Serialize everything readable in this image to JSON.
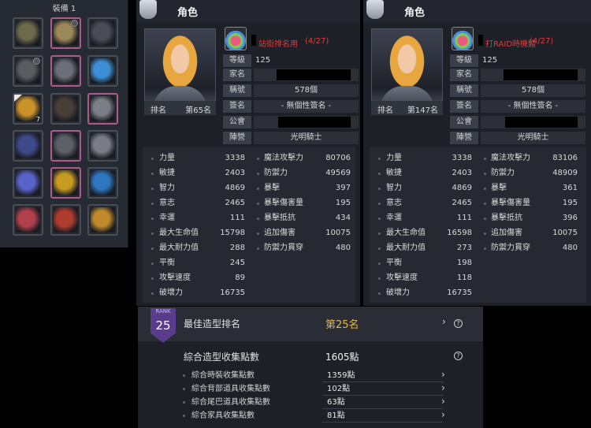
{
  "equipment": {
    "title": "裝備 1",
    "slots": [
      {
        "icon": "necklace-icon",
        "color": "#6b6a4a"
      },
      {
        "icon": "sword-icon",
        "color": "#9c8858"
      },
      {
        "icon": "helmet-icon",
        "color": "#4a4d55"
      },
      {
        "icon": "spear-icon",
        "color": "#5a5d60"
      },
      {
        "icon": "armor-icon",
        "color": "#6c6f78"
      },
      {
        "icon": "gem-icon",
        "color": "#3d8ed6"
      },
      {
        "icon": "potion-icon",
        "color": "#c9922b",
        "count": "7"
      },
      {
        "icon": "cloak-icon",
        "color": "#4a3f38"
      },
      {
        "icon": "glove-icon",
        "color": "#7b7e86"
      },
      {
        "icon": "belt-icon",
        "color": "#3f4a8c"
      },
      {
        "icon": "boots-icon",
        "color": "#5e6068"
      },
      {
        "icon": "shield-icon",
        "color": "#7a7d85"
      },
      {
        "icon": "ring-icon",
        "color": "#5a63c9"
      },
      {
        "icon": "emblem-icon",
        "color": "#c79a22"
      },
      {
        "icon": "bracelet-icon",
        "color": "#2f76c2"
      },
      {
        "icon": "ring-icon",
        "color": "#b2404a"
      },
      {
        "icon": "earring-icon",
        "color": "#b03c2e"
      },
      {
        "icon": "ring-icon",
        "color": "#c08a2a"
      }
    ]
  },
  "panels": [
    {
      "header": "角色",
      "title": "站街排名用",
      "title_count": "(4/27)",
      "level_label": "等級",
      "level": "125",
      "family_label": "家名",
      "nickname_label": "稱號",
      "nickname": "578個",
      "signature_label": "簽名",
      "signature": "- 無個性簽名 -",
      "guild_label": "公會",
      "camp_label": "陣營",
      "camp": "光明騎士",
      "rank_label": "排名",
      "rank": "第65名",
      "stats_left": [
        {
          "label": "力量",
          "value": "3338"
        },
        {
          "label": "敏捷",
          "value": "2403"
        },
        {
          "label": "智力",
          "value": "4869"
        },
        {
          "label": "意志",
          "value": "2465"
        },
        {
          "label": "幸運",
          "value": "111"
        },
        {
          "label": "最大生命值",
          "value": "15798"
        },
        {
          "label": "最大耐力值",
          "value": "288"
        },
        {
          "label": "平衡",
          "value": "245"
        },
        {
          "label": "攻擊速度",
          "value": "89"
        },
        {
          "label": "破壞力",
          "value": "16735"
        }
      ],
      "stats_right": [
        {
          "label": "魔法攻擊力",
          "value": "80706"
        },
        {
          "label": "防禦力",
          "value": "49569"
        },
        {
          "label": "暴擊",
          "value": "397"
        },
        {
          "label": "暴擊傷害量",
          "value": "195"
        },
        {
          "label": "暴擊抵抗",
          "value": "434"
        },
        {
          "label": "追加傷害",
          "value": "10075"
        },
        {
          "label": "防禦力貫穿",
          "value": "480"
        }
      ]
    },
    {
      "header": "角色",
      "title": "打RAID時機體",
      "title_count": "(4/27)",
      "level_label": "等級",
      "level": "125",
      "family_label": "家名",
      "nickname_label": "稱號",
      "nickname": "578個",
      "signature_label": "簽名",
      "signature": "- 無個性簽名 -",
      "guild_label": "公會",
      "camp_label": "陣營",
      "camp": "光明騎士",
      "rank_label": "排名",
      "rank": "第147名",
      "stats_left": [
        {
          "label": "力量",
          "value": "3338"
        },
        {
          "label": "敏捷",
          "value": "2403"
        },
        {
          "label": "智力",
          "value": "4869"
        },
        {
          "label": "意志",
          "value": "2465"
        },
        {
          "label": "幸運",
          "value": "111"
        },
        {
          "label": "最大生命值",
          "value": "16598"
        },
        {
          "label": "最大耐力值",
          "value": "273"
        },
        {
          "label": "平衡",
          "value": "198"
        },
        {
          "label": "攻擊速度",
          "value": "118"
        },
        {
          "label": "破壞力",
          "value": "16735"
        }
      ],
      "stats_right": [
        {
          "label": "魔法攻擊力",
          "value": "83106"
        },
        {
          "label": "防禦力",
          "value": "48909"
        },
        {
          "label": "暴擊",
          "value": "361"
        },
        {
          "label": "暴擊傷害量",
          "value": "195"
        },
        {
          "label": "暴擊抵抗",
          "value": "396"
        },
        {
          "label": "追加傷害",
          "value": "10075"
        },
        {
          "label": "防禦力貫穿",
          "value": "480"
        }
      ]
    }
  ],
  "rank_panel": {
    "badge_caption": "RANK",
    "badge_number": "25",
    "best_label": "最佳造型排名",
    "best_value": "第25名",
    "total_label": "綜合造型收集點數",
    "total_value": "1605點",
    "rows": [
      {
        "label": "綜合時裝收集點數",
        "value": "1359點"
      },
      {
        "label": "綜合背部道具收集點數",
        "value": "102點"
      },
      {
        "label": "綜合尾巴道具收集點數",
        "value": "63點"
      },
      {
        "label": "綜合家具收集點數",
        "value": "81點"
      }
    ],
    "help_glyph": "?",
    "chevron_glyph": "›"
  },
  "colors": {
    "title_red": "#e03b3b",
    "gold_value": "#e6b84a",
    "rank_purple": "#5a3c8c"
  }
}
